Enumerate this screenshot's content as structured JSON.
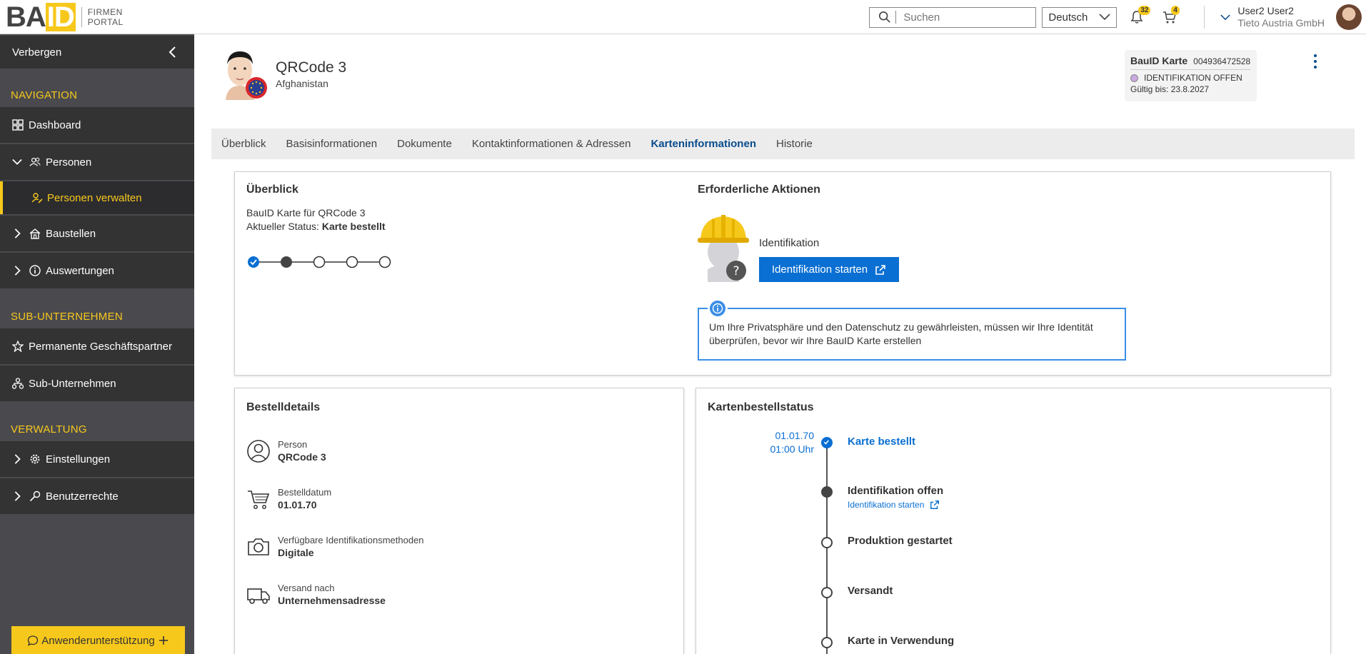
{
  "header": {
    "logo_main_a": "BA",
    "logo_main_b": "ID",
    "logo_sub_1": "FIRMEN",
    "logo_sub_2": "PORTAL",
    "search_placeholder": "Suchen",
    "language": "Deutsch",
    "notifications_count": "32",
    "cart_count": "4",
    "user_name": "User2 User2",
    "user_company": "Tieto Austria GmbH"
  },
  "sidebar": {
    "hide_label": "Verbergen",
    "sections": {
      "navigation": "NAVIGATION",
      "sub": "SUB-UNTERNEHMEN",
      "admin": "VERWALTUNG"
    },
    "items": {
      "dashboard": "Dashboard",
      "personen": "Personen",
      "personen_verwalten": "Personen verwalten",
      "baustellen": "Baustellen",
      "auswertungen": "Auswertungen",
      "partner": "Permanente Geschäftspartner",
      "subunternehmen": "Sub-Unternehmen",
      "einstellungen": "Einstellungen",
      "benutzerrechte": "Benutzerrechte"
    },
    "support_label": "Anwenderunterstützung"
  },
  "profile": {
    "name": "QRCode 3",
    "country": "Afghanistan"
  },
  "card_summary": {
    "title": "BauID Karte",
    "number": "004936472528",
    "status": "IDENTIFIKATION OFFEN",
    "valid": "Gültig bis: 23.8.2027"
  },
  "tabs": [
    "Überblick",
    "Basisinformationen",
    "Dokumente",
    "Kontaktinformationen & Adressen",
    "Karteninformationen",
    "Historie"
  ],
  "overview": {
    "title": "Überblick",
    "line1": "BauID Karte für QRCode 3",
    "status_prefix": "Aktueller Status: ",
    "status_value": "Karte bestellt",
    "actions_title": "Erforderliche Aktionen",
    "ident_label": "Identifikation",
    "ident_button": "Identifikation starten",
    "info_text": "Um Ihre Privatsphäre und den Datenschutz zu gewährleisten, müssen wir Ihre Identität überprüfen, bevor wir Ihre BauID Karte erstellen"
  },
  "order": {
    "title": "Bestelldetails",
    "person_label": "Person",
    "person_value": "QRCode 3",
    "date_label": "Bestelldatum",
    "date_value": "01.01.70",
    "methods_label": "Verfügbare Identifikationsmethoden",
    "methods_value": "Digitale",
    "shipping_label": "Versand nach",
    "shipping_value": "Unternehmensadresse"
  },
  "status": {
    "title": "Kartenbestellstatus",
    "date": "01.01.70",
    "time": "01:00 Uhr",
    "steps": {
      "s1": "Karte bestellt",
      "s2": "Identifikation offen",
      "s2_link": "Identifikation starten",
      "s3": "Produktion gestartet",
      "s4": "Versandt",
      "s5": "Karte in Verwendung"
    }
  },
  "colors": {
    "accent": "#f7c81c",
    "primary": "#0a6fd2",
    "sidebar": "#4a4a4e"
  }
}
